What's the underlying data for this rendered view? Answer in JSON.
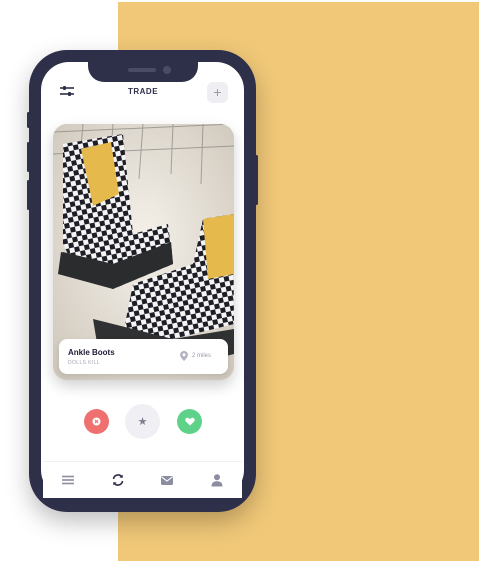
{
  "header": {
    "title": "TRADE",
    "add_label": "+"
  },
  "item": {
    "name": "Ankle Boots",
    "brand": "DOLLS KILL",
    "distance": "2 miles"
  },
  "actions": {
    "star_label": "★"
  },
  "icons": {
    "filter": "sliders-icon",
    "add": "plus-icon",
    "location": "map-pin-icon",
    "dislike": "x-icon",
    "favorite": "star-icon",
    "like": "heart-icon",
    "menu": "menu-icon",
    "trade": "sync-icon",
    "messages": "mail-icon",
    "profile": "user-icon"
  },
  "colors": {
    "background_panel": "#f0c878",
    "phone_frame": "#2e2f49",
    "dislike": "#f07070",
    "like": "#5fd28a",
    "checker_dark": "#1e1e26",
    "checker_light": "#f4f4f4",
    "boot_accent": "#e5b94c"
  }
}
